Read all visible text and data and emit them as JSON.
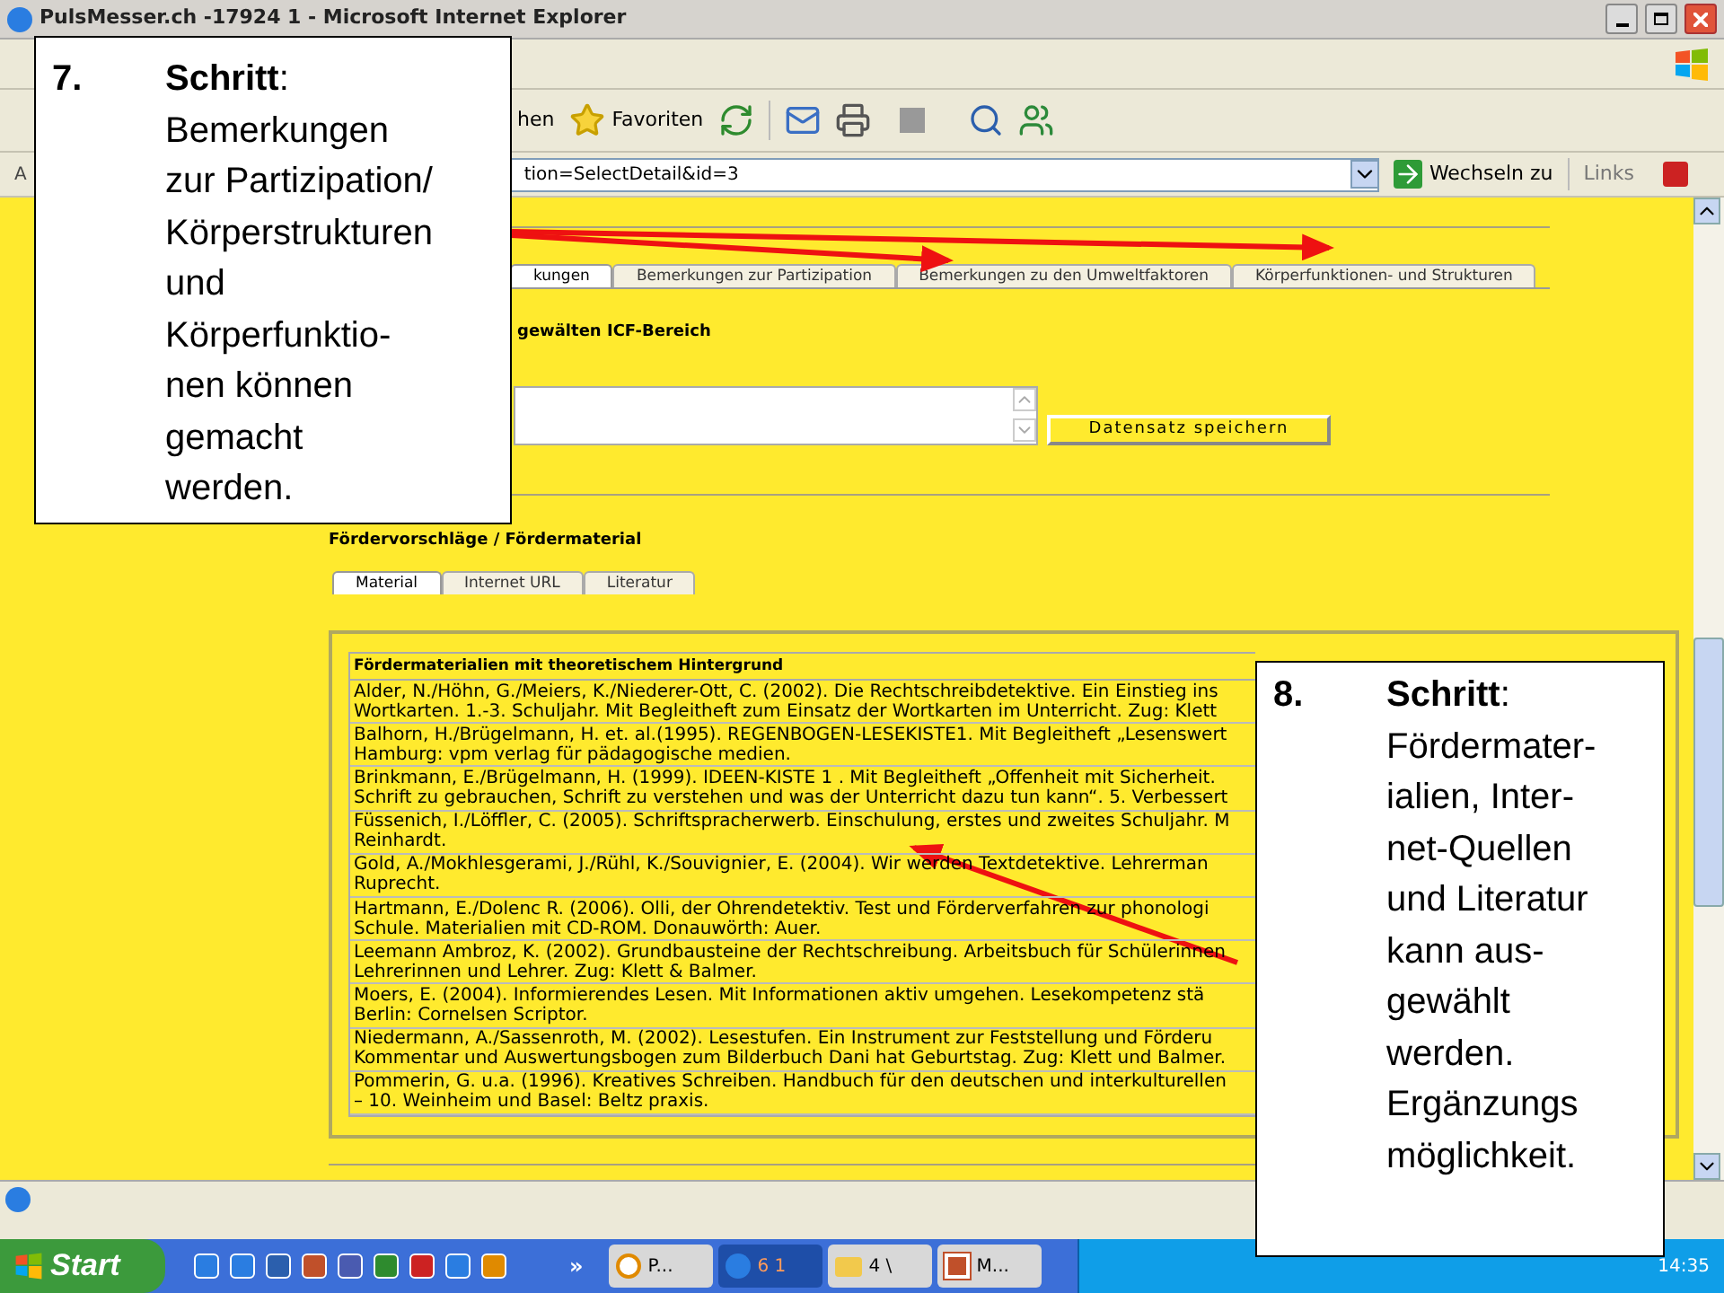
{
  "window": {
    "title": "PulsMesser.ch -17924 1 - Microsoft Internet Explorer"
  },
  "toolbar": {
    "search_fragment": "hen",
    "favorites": "Favoriten"
  },
  "address_bar": {
    "label": "A",
    "value": "tion=SelectDetail&id=3",
    "go": "Wechseln zu",
    "links": "Links"
  },
  "tabs": [
    {
      "label": "kungen",
      "selected": true
    },
    {
      "label": "Bemerkungen zur Partizipation",
      "selected": false
    },
    {
      "label": "Bemerkungen zu den Umweltfaktoren",
      "selected": false
    },
    {
      "label": "Körperfunktionen- und Strukturen",
      "selected": false
    }
  ],
  "section_heading": "gewälten ICF-Bereich",
  "save_button": "Datensatz speichern",
  "material_heading": "Fördervorschläge / Fördermaterial",
  "material_tabs": [
    {
      "label": "Material",
      "selected": true
    },
    {
      "label": "Internet URL",
      "selected": false
    },
    {
      "label": "Literatur",
      "selected": false
    }
  ],
  "list": {
    "header": "Fördermaterialien mit theoretischem Hintergrund",
    "rows": [
      [
        "Alder, N./Höhn, G./Meiers, K./Niederer-Ott, C. (2002). Die Rechtschreibdetektive. Ein Einstieg ins",
        "Wortkarten. 1.-3. Schuljahr. Mit Begleitheft zum Einsatz der Wortkarten im Unterricht. Zug: Klett"
      ],
      [
        "Balhorn, H./Brügelmann, H. et. al.(1995). REGENBOGEN-LESEKISTE1. Mit Begleitheft „Lesenswert",
        "Hamburg: vpm verlag für pädagogische medien."
      ],
      [
        "Brinkmann, E./Brügelmann, H. (1999). IDEEN-KISTE 1 . Mit Begleitheft „Offenheit mit Sicherheit.",
        "Schrift zu gebrauchen, Schrift zu verstehen und was der Unterricht dazu tun kann“. 5. Verbessert"
      ],
      [
        "Füssenich, I./Löffler, C. (2005). Schriftspracherwerb. Einschulung, erstes und zweites Schuljahr. M",
        "Reinhardt."
      ],
      [
        "Gold, A./Mokhlesgerami, J./Rühl, K./Souvignier, E. (2004). Wir werden Textdetektive. Lehrerman",
        "Ruprecht."
      ],
      [
        "Hartmann, E./Dolenc R. (2006). Olli, der Ohrendetektiv. Test und Förderverfahren zur phonologi",
        "Schule. Materialien mit CD-ROM. Donauwörth: Auer."
      ],
      [
        "Leemann Ambroz, K. (2002). Grundbausteine der Rechtschreibung. Arbeitsbuch für Schülerinnen",
        "Lehrerinnen und Lehrer. Zug: Klett & Balmer."
      ],
      [
        "Moers, E. (2004). Informierendes Lesen. Mit Informationen aktiv umgehen. Lesekompetenz stä",
        "Berlin: Cornelsen Scriptor."
      ],
      [
        "Niedermann, A./Sassenroth, M. (2002). Lesestufen. Ein Instrument zur Feststellung und Förderu",
        "Kommentar und Auswertungsbogen zum Bilderbuch Dani hat Geburtstag. Zug: Klett und Balmer."
      ],
      [
        "Pommerin, G. u.a. (1996). Kreatives Schreiben. Handbuch für den deutschen und interkulturellen",
        "– 10. Weinheim und Basel: Beltz praxis."
      ]
    ]
  },
  "taskbar": {
    "start": "Start",
    "overflow": "»",
    "tasks": [
      {
        "label": "P...",
        "kind": "clock",
        "selected": false
      },
      {
        "label": "6 1",
        "kind": "ie",
        "selected": true
      },
      {
        "label": "4 \\",
        "kind": "folder",
        "selected": false
      },
      {
        "label": "M...",
        "kind": "slides",
        "selected": false
      }
    ],
    "clock": "14:35"
  },
  "callouts": [
    {
      "number": "7.",
      "title": "**Schritt**:",
      "body": "Bemerkungen\nzur Partizipation/\nKörperstrukturen\nund\nKörperfunktio-\nnen können\ngemacht\nwerden."
    },
    {
      "number": "8.",
      "title": "**Schritt**:",
      "body": "Fördermater-\nialien, Inter-\nnet-Quellen\nund Literatur\nkann aus-\ngewählt\nwerden.\nErgänzungs\nmöglichkeit."
    }
  ]
}
